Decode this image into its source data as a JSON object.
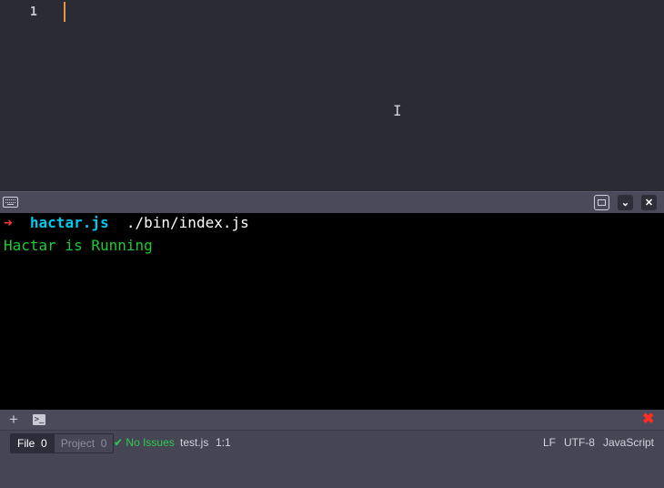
{
  "editor": {
    "line_number": "1",
    "ibeam_glyph": "I"
  },
  "terminal_header": {
    "keyboard_icon": "keyboard-icon",
    "maximize_icon": "maximize-icon",
    "collapse_icon": "chevron-down-icon",
    "collapse_glyph": "⌄",
    "close_icon": "close-icon",
    "close_glyph": "✕"
  },
  "terminal": {
    "prompt_arrow": "➜",
    "command": "hactar.js",
    "argument": "./bin/index.js",
    "output": "Hactar is Running",
    "colors": {
      "arrow": "#ff3b2f",
      "command": "#00c8e8",
      "output": "#1ecb32"
    }
  },
  "terminal_tabs": {
    "add_glyph": "+",
    "prompt_glyph": ">_",
    "close_glyph": "✖"
  },
  "status_bar": {
    "file_label": "File",
    "file_count": "0",
    "project_label": "Project",
    "project_count": "0",
    "issues_glyph": "✔",
    "issues_text": "No Issues",
    "filename": "test.js",
    "cursor_position": "1:1",
    "line_ending": "LF",
    "encoding": "UTF-8",
    "grammar": "JavaScript"
  }
}
